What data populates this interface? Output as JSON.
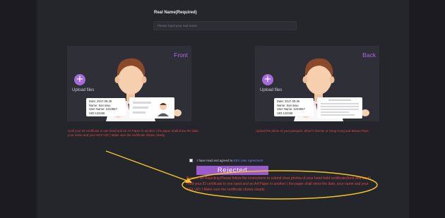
{
  "form": {
    "real_name_label": "Real Name(Required)",
    "real_name_placeholder": "Please input your real name"
  },
  "front_card": {
    "title": "Front",
    "upload_label": "Upload files",
    "id_date": "Date:  2017.09.26",
    "id_name": "Name: San siwu",
    "id_user": "User Name:  1234567",
    "id_uid": "UID:123456",
    "note": "Hold your ID certificate in one hand and an A4 Paper in another ( the paper shall show the date, your name and your KEX UID ) Make sure the certificate shows clearly"
  },
  "back_card": {
    "title": "Back",
    "upload_label": "Upload files",
    "id_date": "Date:  2017.09.26",
    "id_name": "Name: San siwu",
    "id_user": "User Name:  1234567",
    "id_uid": "UID:123456",
    "note": "Upload the photo of your passport, driver's license or Hong Kong and Macau Pass"
  },
  "agreement": {
    "text": "I have read and agreed to",
    "link": "KEX User Agreement"
  },
  "status": {
    "button_label": "Rejected",
    "reason": "Reason for Rejecting:Please follow the instructions to submit clear photos of your hand-held certificate(front and back). Hold your ID certificate in one hand and an A4 Paper in another ( the paper shall show the date, your name and your KEX UID ) Make sure the certificate shows clearly."
  },
  "colors": {
    "accent": "#a56bd8",
    "error": "#e04848",
    "annotation": "#f2c22a"
  }
}
